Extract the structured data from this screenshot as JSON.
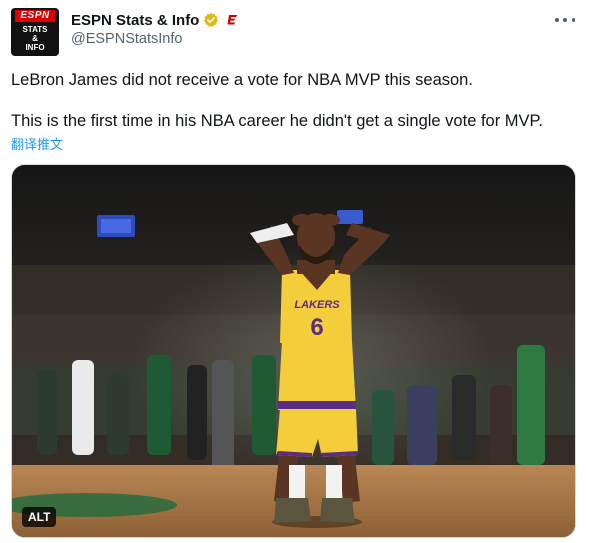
{
  "account": {
    "display_name": "ESPN Stats & Info",
    "handle": "@ESPNStatsInfo",
    "avatar_logo": "ESPN",
    "avatar_lines": [
      "STATS",
      "&",
      "INFO"
    ],
    "verified_color": "#e2b719",
    "affiliation_color": "#d00000"
  },
  "tweet": {
    "line1": "LeBron James did not receive a vote for NBA MVP this season.",
    "line2": "This is the first time in his NBA career he didn't get a single vote for MVP.",
    "translate_label": "翻译推文"
  },
  "media": {
    "alt_label": "ALT",
    "jersey_text": "LAKERS",
    "jersey_number": "6"
  },
  "icons": {
    "more": "more-dots-icon",
    "verified": "gold-verified-badge-icon",
    "affiliate": "espn-affiliate-icon"
  },
  "colors": {
    "link": "#1d9bf0",
    "secondary": "#536471",
    "jersey": "#f4cd3a",
    "jersey_trim": "#5a2d82"
  }
}
